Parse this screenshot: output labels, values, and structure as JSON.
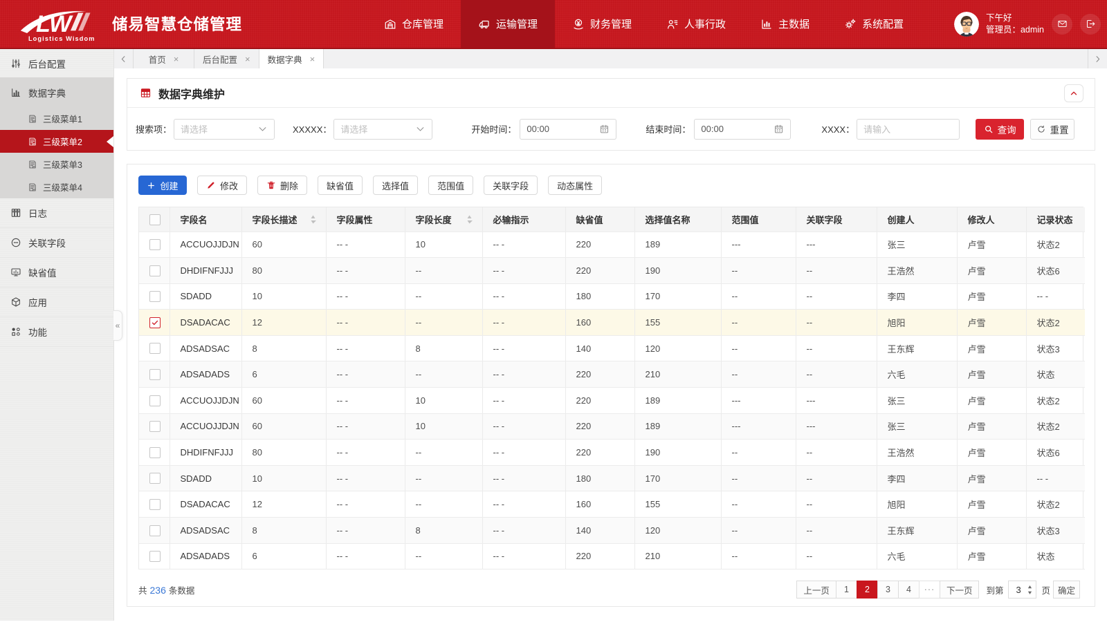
{
  "header": {
    "logo": {
      "mark": "LW",
      "subtitle": "Logistics Wisdom"
    },
    "app_title": "储易智慧仓储管理",
    "nav": [
      {
        "label": "仓库管理",
        "icon": "warehouse-icon",
        "active": false
      },
      {
        "label": "运输管理",
        "icon": "truck-icon",
        "active": true
      },
      {
        "label": "财务管理",
        "icon": "finance-icon",
        "active": false
      },
      {
        "label": "人事行政",
        "icon": "people-icon",
        "active": false
      },
      {
        "label": "主数据",
        "icon": "chart-icon",
        "active": false
      },
      {
        "label": "系统配置",
        "icon": "gears-icon",
        "active": false
      }
    ],
    "user": {
      "greeting": "下午好",
      "role": "管理员：admin"
    }
  },
  "sidebar": {
    "items": [
      {
        "label": "后台配置",
        "icon": "sliders-icon",
        "type": "top"
      },
      {
        "label": "数据字典",
        "icon": "barchart-icon",
        "type": "group"
      },
      {
        "label": "三级菜单1",
        "icon": "document-icon",
        "type": "sub"
      },
      {
        "label": "三级菜单2",
        "icon": "document-icon",
        "type": "sub",
        "active": true
      },
      {
        "label": "三级菜单3",
        "icon": "document-icon",
        "type": "sub"
      },
      {
        "label": "三级菜单4",
        "icon": "document-icon",
        "type": "sub"
      },
      {
        "label": "日志",
        "icon": "archive-icon",
        "type": "top"
      },
      {
        "label": "关联字段",
        "icon": "link-icon",
        "type": "top"
      },
      {
        "label": "缺省值",
        "icon": "monitor-icon",
        "type": "top"
      },
      {
        "label": "应用",
        "icon": "cube-icon",
        "type": "top"
      },
      {
        "label": "功能",
        "icon": "shapes-icon",
        "type": "top"
      }
    ],
    "collapse_handle": "«"
  },
  "tabs": [
    {
      "label": "首页",
      "active": false
    },
    {
      "label": "后台配置",
      "active": false
    },
    {
      "label": "数据字典",
      "active": true
    }
  ],
  "panel": {
    "title": "数据字典维护"
  },
  "search": {
    "field1_label": "搜索项：",
    "field1_placeholder": "请选择",
    "field2_label": "XXXXX：",
    "field2_placeholder": "请选择",
    "start_label": "开始时间：",
    "start_value": "00:00",
    "end_label": "结束时间：",
    "end_value": "00:00",
    "field5_label": "XXXX：",
    "field5_placeholder": "请输入",
    "query_label": "查询",
    "reset_label": "重置"
  },
  "toolbar": {
    "create": "创建",
    "modify": "修改",
    "delete": "删除",
    "default_value": "缺省值",
    "select_value": "选择值",
    "range_value": "范围值",
    "related_field": "关联字段",
    "dynamic_attr": "动态属性"
  },
  "table": {
    "columns": [
      "字段名",
      "字段长描述",
      "字段属性",
      "字段长度",
      "必输指示",
      "缺省值",
      "选择值名称",
      "范围值",
      "关联字段",
      "创建人",
      "修改人",
      "记录状态"
    ],
    "sortable_columns": [
      "字段长描述",
      "字段长度"
    ],
    "rows": [
      {
        "checked": false,
        "cells": [
          "ACCUOJJDJN",
          "60",
          "-- -",
          "10",
          "-- -",
          "220",
          "189",
          "---",
          "---",
          "张三",
          "卢雪",
          "状态2"
        ]
      },
      {
        "checked": false,
        "cells": [
          "DHDIFNFJJJ",
          "80",
          "-- -",
          "--",
          "-- -",
          "220",
          "190",
          "--",
          "--",
          "王浩然",
          "卢雪",
          "状态6"
        ]
      },
      {
        "checked": false,
        "cells": [
          "SDADD",
          "10",
          "-- -",
          "--",
          "-- -",
          "180",
          "170",
          "--",
          "--",
          "李四",
          "卢雪",
          "-- -"
        ]
      },
      {
        "checked": true,
        "cells": [
          "DSADACAC",
          "12",
          "-- -",
          "--",
          "-- -",
          "160",
          "155",
          "--",
          "--",
          "旭阳",
          "卢雪",
          "状态2"
        ]
      },
      {
        "checked": false,
        "cells": [
          "ADSADSAC",
          "8",
          "-- -",
          "8",
          "-- -",
          "140",
          "120",
          "--",
          "--",
          "王东辉",
          "卢雪",
          "状态3"
        ]
      },
      {
        "checked": false,
        "cells": [
          "ADSADADS",
          "6",
          "-- -",
          "--",
          "-- -",
          "220",
          "210",
          "--",
          "--",
          "六毛",
          "卢雪",
          "状态"
        ]
      },
      {
        "checked": false,
        "cells": [
          "ACCUOJJDJN",
          "60",
          "-- -",
          "10",
          "-- -",
          "220",
          "189",
          "---",
          "---",
          "张三",
          "卢雪",
          "状态2"
        ]
      },
      {
        "checked": false,
        "cells": [
          "ACCUOJJDJN",
          "60",
          "-- -",
          "10",
          "-- -",
          "220",
          "189",
          "---",
          "---",
          "张三",
          "卢雪",
          "状态2"
        ]
      },
      {
        "checked": false,
        "cells": [
          "DHDIFNFJJJ",
          "80",
          "-- -",
          "--",
          "-- -",
          "220",
          "190",
          "--",
          "--",
          "王浩然",
          "卢雪",
          "状态6"
        ]
      },
      {
        "checked": false,
        "cells": [
          "SDADD",
          "10",
          "-- -",
          "--",
          "-- -",
          "180",
          "170",
          "--",
          "--",
          "李四",
          "卢雪",
          "-- -"
        ]
      },
      {
        "checked": false,
        "cells": [
          "DSADACAC",
          "12",
          "-- -",
          "--",
          "-- -",
          "160",
          "155",
          "--",
          "--",
          "旭阳",
          "卢雪",
          "状态2"
        ]
      },
      {
        "checked": false,
        "cells": [
          "ADSADSAC",
          "8",
          "-- -",
          "8",
          "-- -",
          "140",
          "120",
          "--",
          "--",
          "王东辉",
          "卢雪",
          "状态3"
        ]
      },
      {
        "checked": false,
        "cells": [
          "ADSADADS",
          "6",
          "-- -",
          "--",
          "-- -",
          "220",
          "210",
          "--",
          "--",
          "六毛",
          "卢雪",
          "状态"
        ]
      }
    ]
  },
  "footer": {
    "total_prefix": "共",
    "total_count": "236",
    "total_suffix": "条数据",
    "prev": "上一页",
    "next": "下一页",
    "pages": [
      "1",
      "2",
      "3",
      "4"
    ],
    "current_page": "2",
    "ellipsis": "···",
    "goto_label": "到第",
    "goto_value": "3",
    "goto_unit": "页",
    "confirm": "确定"
  },
  "colors": {
    "header_red": "#c9171e",
    "header_active_red": "#a5121a",
    "sidebar_active_red": "#b5151b",
    "accent_red": "#d0212b",
    "create_blue": "#2767d4",
    "link_blue": "#3a78d6",
    "row_highlight": "#fdf9e7"
  }
}
